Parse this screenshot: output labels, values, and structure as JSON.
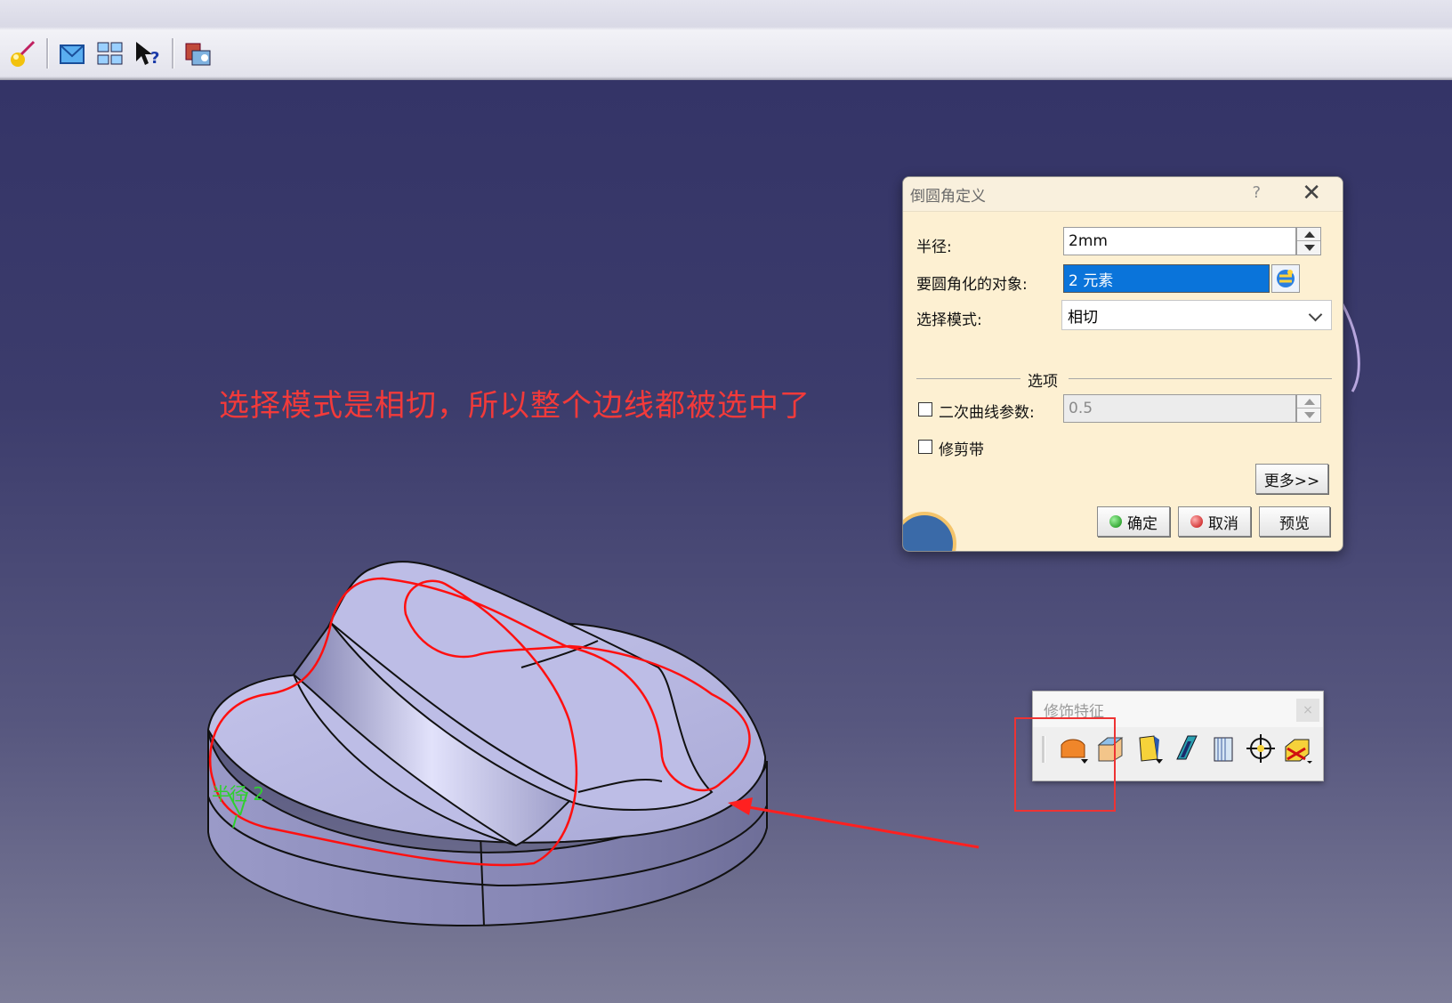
{
  "toolbar": {
    "icons": [
      "sketch-icon",
      "mail-icon",
      "multi-view-icon",
      "whats-this-icon",
      "catalog-icon"
    ]
  },
  "viewport": {
    "annotation": "选择模式是相切，所以整个边线都被选中了",
    "radius_label": "半径 2"
  },
  "dialog": {
    "title": "倒圆角定义",
    "help": "?",
    "close": "✕",
    "radius_label": "半径:",
    "radius_value": "2mm",
    "objects_label": "要圆角化的对象:",
    "objects_value": "2 元素",
    "mode_label": "选择模式:",
    "mode_value": "相切",
    "options_label": "选项",
    "conic_label": "二次曲线参数:",
    "conic_value": "0.5",
    "trim_label": "修剪带",
    "more_label": "更多>>",
    "ok_label": "确定",
    "cancel_label": "取消",
    "preview_label": "预览"
  },
  "dress_toolbar": {
    "title": "修饰特征",
    "close": "×",
    "icons": [
      "edge-fillet-icon",
      "chamfer-icon",
      "draft-icon",
      "shell-icon",
      "thickness-icon",
      "thread-icon",
      "remove-face-icon"
    ]
  },
  "colors": {
    "annotation": "#f23a3a",
    "selection_highlight": "#0a74da",
    "part_face": "#b8b8e0",
    "selected_edge": "#ff1010"
  }
}
